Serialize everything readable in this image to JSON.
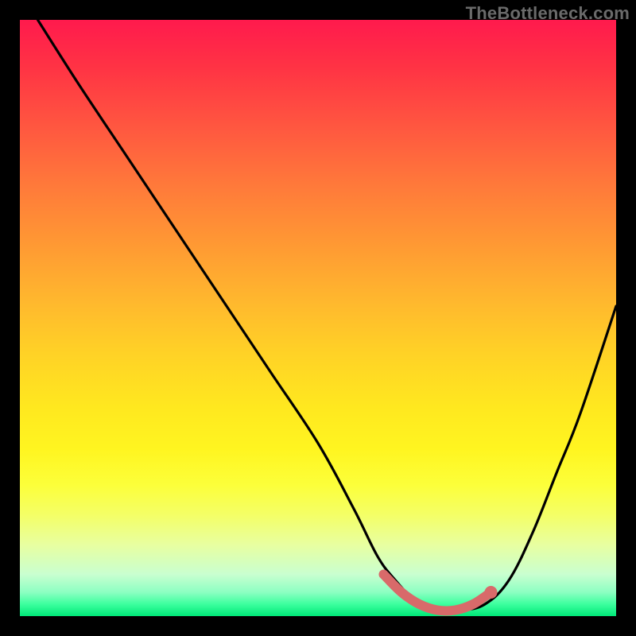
{
  "watermark": "TheBottleneck.com",
  "colors": {
    "background": "#000000",
    "curve_stroke": "#000000",
    "highlight_stroke": "#d86a6a",
    "gradient_top": "#ff1a4d",
    "gradient_bottom": "#00e878"
  },
  "chart_data": {
    "type": "line",
    "title": "",
    "xlabel": "",
    "ylabel": "",
    "xlim": [
      0,
      100
    ],
    "ylim": [
      0,
      100
    ],
    "grid": false,
    "legend": false,
    "annotations": [],
    "series": [
      {
        "name": "bottleneck-curve",
        "x": [
          3,
          10,
          18,
          26,
          34,
          42,
          50,
          56,
          60,
          63,
          66,
          70,
          74,
          78,
          82,
          86,
          90,
          94,
          100
        ],
        "y": [
          100,
          89,
          77,
          65,
          53,
          41,
          29,
          18,
          10,
          6,
          3,
          1,
          1,
          2,
          6,
          14,
          24,
          34,
          52
        ]
      },
      {
        "name": "highlight-segment",
        "x": [
          61,
          64,
          67,
          70,
          73,
          76,
          79
        ],
        "y": [
          7,
          4,
          2,
          1,
          1,
          2,
          4
        ]
      }
    ],
    "highlight_dot": {
      "x": 79,
      "y": 4
    }
  }
}
